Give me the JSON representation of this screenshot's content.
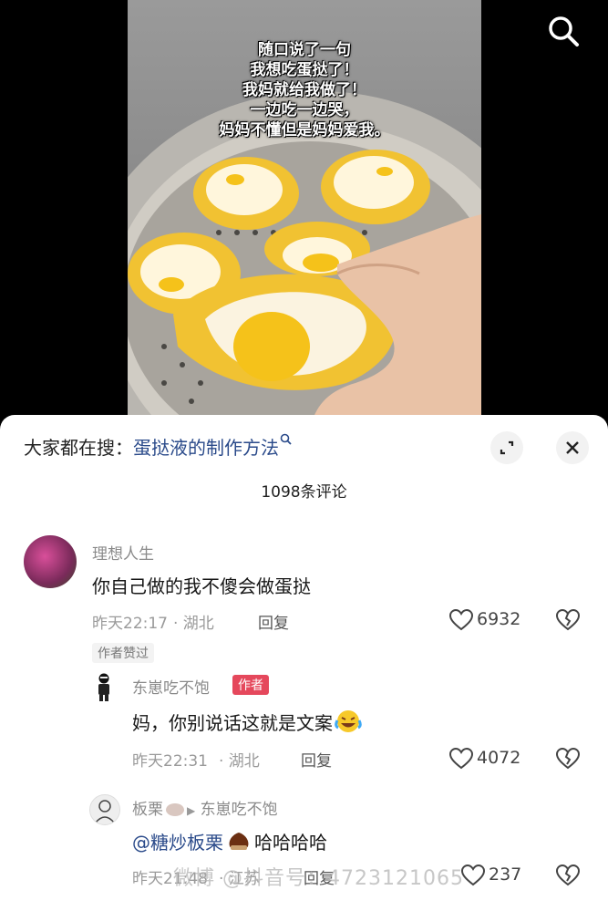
{
  "video": {
    "caption_lines": [
      "随口说了一句",
      "我想吃蛋挞了！",
      "我妈就给我做了！",
      "一边吃一边哭，",
      "妈妈不懂但是妈妈爱我。"
    ]
  },
  "sheet": {
    "hot_search_prefix": "大家都在搜：",
    "hot_search_query": "蛋挞液的制作方法",
    "comment_count": "1098条评论"
  },
  "comments": [
    {
      "user": "理想人生",
      "text": "你自己做的我不傻会做蛋挞",
      "time": "昨天22:17",
      "location": "· 湖北",
      "reply_label": "回复",
      "likes": "6932",
      "tag": "作者赞过"
    },
    {
      "user": "东崽吃不饱",
      "badge": "作者",
      "text": "妈，你别说话这就是文案",
      "time": "昨天22:31",
      "location": "· 湖北",
      "reply_label": "回复",
      "likes": "4072"
    },
    {
      "user": "板栗",
      "reply_to": "东崽吃不饱",
      "mention": "@糖炒板栗",
      "text": "哈哈哈哈",
      "time": "昨天21:48",
      "location": "· 江苏",
      "reply_label": "回复",
      "likes": "237"
    }
  ],
  "watermark": "微博 @抖音号：4723121065",
  "colors": {
    "author_badge": "#e5485c",
    "link": "#2a4a8a",
    "yolk": "#f5c21a",
    "tart_shell": "#f4d03f"
  }
}
